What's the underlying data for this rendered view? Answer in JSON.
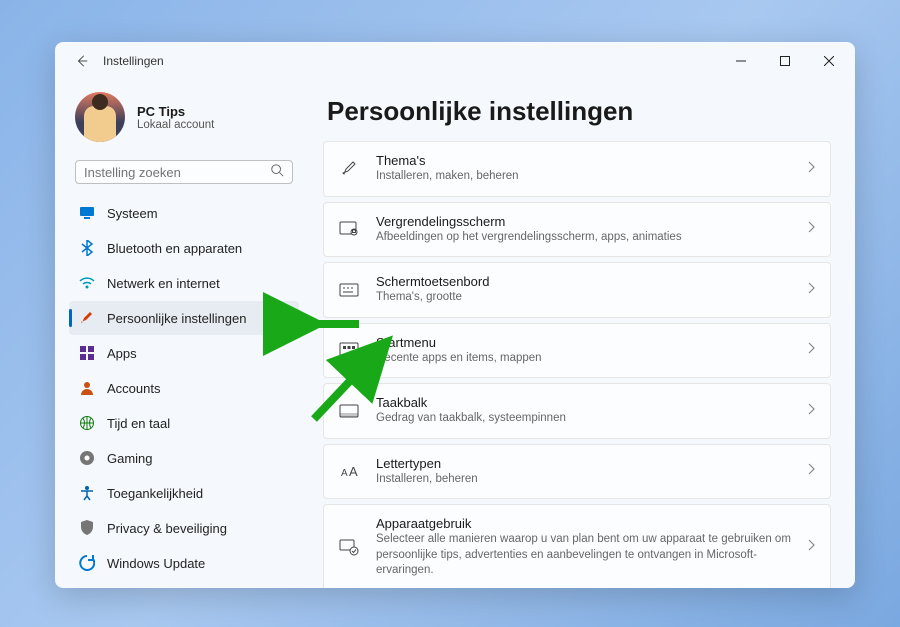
{
  "window": {
    "title": "Instellingen"
  },
  "user": {
    "name": "PC Tips",
    "subtitle": "Lokaal account"
  },
  "search": {
    "placeholder": "Instelling zoeken"
  },
  "sidebar": {
    "items": [
      {
        "icon": "monitor-icon",
        "label": "Systeem",
        "color": "#0078d4"
      },
      {
        "icon": "bluetooth-icon",
        "label": "Bluetooth en apparaten",
        "color": "#0078d4"
      },
      {
        "icon": "wifi-icon",
        "label": "Netwerk en internet",
        "color": "#0099bc"
      },
      {
        "icon": "brush-icon",
        "label": "Persoonlijke instellingen",
        "color": "#d83b01",
        "active": true
      },
      {
        "icon": "grid-icon",
        "label": "Apps",
        "color": "#5c2d91"
      },
      {
        "icon": "person-icon",
        "label": "Accounts",
        "color": "#ca5010"
      },
      {
        "icon": "globe-icon",
        "label": "Tijd en taal",
        "color": "#107c10"
      },
      {
        "icon": "gaming-icon",
        "label": "Gaming",
        "color": "#767676"
      },
      {
        "icon": "accessibility-icon",
        "label": "Toegankelijkheid",
        "color": "#0063b1"
      },
      {
        "icon": "shield-icon",
        "label": "Privacy & beveiliging",
        "color": "#767676"
      },
      {
        "icon": "update-icon",
        "label": "Windows Update",
        "color": "#0078d4"
      }
    ]
  },
  "page": {
    "title": "Persoonlijke instellingen"
  },
  "cards": [
    {
      "icon": "brush-outline-icon",
      "title": "Thema's",
      "subtitle": "Installeren, maken, beheren"
    },
    {
      "icon": "lockscreen-icon",
      "title": "Vergrendelingsscherm",
      "subtitle": "Afbeeldingen op het vergrendelingsscherm, apps, animaties"
    },
    {
      "icon": "keyboard-icon",
      "title": "Schermtoetsenbord",
      "subtitle": "Thema's, grootte"
    },
    {
      "icon": "startmenu-icon",
      "title": "Startmenu",
      "subtitle": "Recente apps en items, mappen"
    },
    {
      "icon": "taskbar-icon",
      "title": "Taakbalk",
      "subtitle": "Gedrag van taakbalk, systeempinnen"
    },
    {
      "icon": "fonts-icon",
      "title": "Lettertypen",
      "subtitle": "Installeren, beheren"
    },
    {
      "icon": "deviceusage-icon",
      "title": "Apparaatgebruik",
      "subtitle": "Selecteer alle manieren waarop u van plan bent om uw apparaat te gebruiken om persoonlijke tips, advertenties en aanbevelingen te ontvangen in Microsoft-ervaringen."
    }
  ]
}
